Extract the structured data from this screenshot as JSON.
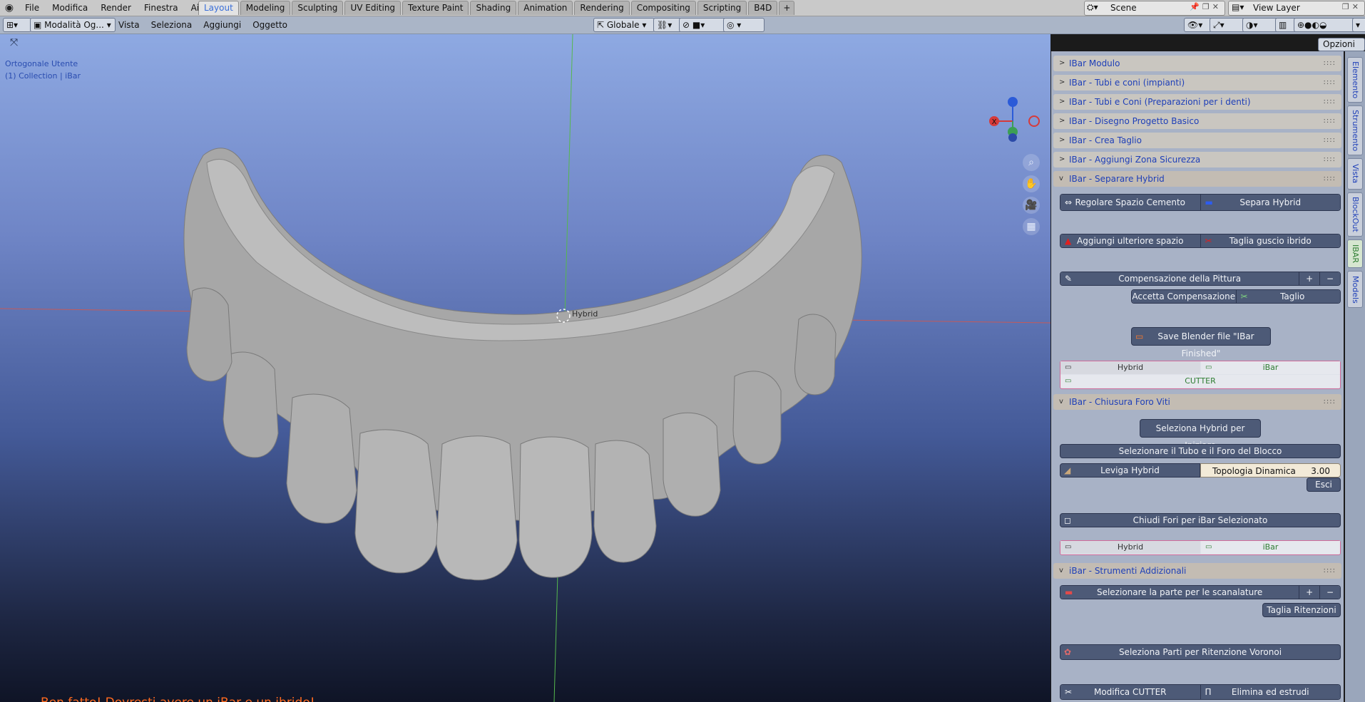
{
  "menu": [
    "File",
    "Modifica",
    "Render",
    "Finestra",
    "Aiuto"
  ],
  "workspaces": {
    "active": "Layout",
    "items": [
      "Layout",
      "Modeling",
      "Sculpting",
      "UV Editing",
      "Texture Paint",
      "Shading",
      "Animation",
      "Rendering",
      "Compositing",
      "Scripting",
      "B4D"
    ]
  },
  "scene": {
    "name": "Scene"
  },
  "view_layer": {
    "name": "View Layer"
  },
  "header": {
    "mode": "Modalità Og...",
    "menus": [
      "Vista",
      "Seleziona",
      "Aggiungi",
      "Oggetto"
    ],
    "orientation": "Globale",
    "options": "Opzioni"
  },
  "viewport": {
    "view_name": "Ortogonale Utente",
    "collection": "(1) Collection | iBar",
    "object_label": "Hybrid",
    "message": "Ben fatto! Dovresti avere un iBar e un ibrido!",
    "gizmo": {
      "x": "X",
      "z_color": "#2b5bd8",
      "x_color": "#d63a3a",
      "y_color": "#3c9f55"
    }
  },
  "panels": [
    {
      "label": "IBar Modulo",
      "open": false
    },
    {
      "label": "IBar - Tubi e coni (impianti)",
      "open": false
    },
    {
      "label": "IBar - Tubi e Coni (Preparazioni per i denti)",
      "open": false
    },
    {
      "label": "IBar - Disegno Progetto Basico",
      "open": false
    },
    {
      "label": "IBar - Crea Taglio",
      "open": false
    },
    {
      "label": "IBar - Aggiungi Zona Sicurezza",
      "open": false
    },
    {
      "label": "IBar - Separare Hybrid",
      "open": true
    },
    {
      "label": "IBar - Chiusura Foro  Viti",
      "open": true
    },
    {
      "label": "iBar - Strumenti Addizionali",
      "open": true
    }
  ],
  "separare": {
    "regolare": "Regolare Spazio Cemento",
    "separa": "Separa Hybrid",
    "aggiungi": "Aggiungi ulteriore spazio",
    "taglia_guscio": "Taglia guscio ibrido",
    "compensazione": "Compensazione della Pittura",
    "accetta": "Accetta Compensazione",
    "taglio_comp": "Taglio Compensazione",
    "save": "Save Blender file \"IBar Finished\"",
    "vis_hybrid": "Hybrid",
    "vis_ibar": "iBar",
    "vis_cutter": "CUTTER"
  },
  "chiusura": {
    "seleziona": "Seleziona Hybrid per Iniziare",
    "selezionare_tubo": "Selezionare il Tubo e il Foro del Blocco",
    "leviga": "Leviga Hybrid",
    "topologia_label": "Topologia Dinamica",
    "topologia_value": "3.00",
    "esci": "Esci",
    "chiudi": "Chiudi Fori per iBar Selezionato",
    "vis_hybrid": "Hybrid",
    "vis_ibar": "iBar"
  },
  "strumenti": {
    "scanalature": "Selezionare la parte per le scanalature",
    "taglia_rit": "Taglia Ritenzioni",
    "voronoi": "Seleziona Parti per Ritenzione Voronoi",
    "modifica": "Modifica CUTTER",
    "elimina": "Elimina ed estrudi"
  },
  "sidetabs": [
    "Elemento",
    "Strumento",
    "Vista",
    "BlockOut",
    "IBAR",
    "Models"
  ],
  "sidetab_active": "IBAR"
}
